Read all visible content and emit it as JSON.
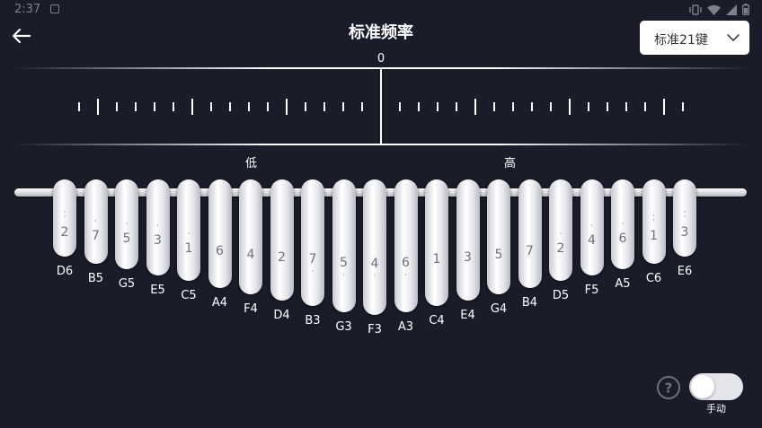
{
  "status": {
    "time": "2:37"
  },
  "header": {
    "title": "标准频率",
    "dropdown_label": "标准21键"
  },
  "meter": {
    "zero_label": "0",
    "low_label": "低",
    "high_label": "高"
  },
  "tines": [
    {
      "note": "D6",
      "digit": "2",
      "dots": "high2"
    },
    {
      "note": "B5",
      "digit": "7",
      "dots": "high1"
    },
    {
      "note": "G5",
      "digit": "5",
      "dots": "high1"
    },
    {
      "note": "E5",
      "digit": "3",
      "dots": "high1"
    },
    {
      "note": "C5",
      "digit": "1",
      "dots": "high1"
    },
    {
      "note": "A4",
      "digit": "6",
      "dots": "none"
    },
    {
      "note": "F4",
      "digit": "4",
      "dots": "none"
    },
    {
      "note": "D4",
      "digit": "2",
      "dots": "none"
    },
    {
      "note": "B3",
      "digit": "7",
      "dots": "low1"
    },
    {
      "note": "G3",
      "digit": "5",
      "dots": "low1"
    },
    {
      "note": "F3",
      "digit": "4",
      "dots": "low1"
    },
    {
      "note": "A3",
      "digit": "6",
      "dots": "low1"
    },
    {
      "note": "C4",
      "digit": "1",
      "dots": "none"
    },
    {
      "note": "E4",
      "digit": "3",
      "dots": "none"
    },
    {
      "note": "G4",
      "digit": "5",
      "dots": "none"
    },
    {
      "note": "B4",
      "digit": "7",
      "dots": "none"
    },
    {
      "note": "D5",
      "digit": "2",
      "dots": "high1"
    },
    {
      "note": "F5",
      "digit": "4",
      "dots": "high1"
    },
    {
      "note": "A5",
      "digit": "6",
      "dots": "high1"
    },
    {
      "note": "C6",
      "digit": "1",
      "dots": "high2"
    },
    {
      "note": "E6",
      "digit": "3",
      "dots": "high2"
    }
  ],
  "controls": {
    "help_symbol": "?",
    "mode_label": "手动",
    "mode_on": false
  }
}
